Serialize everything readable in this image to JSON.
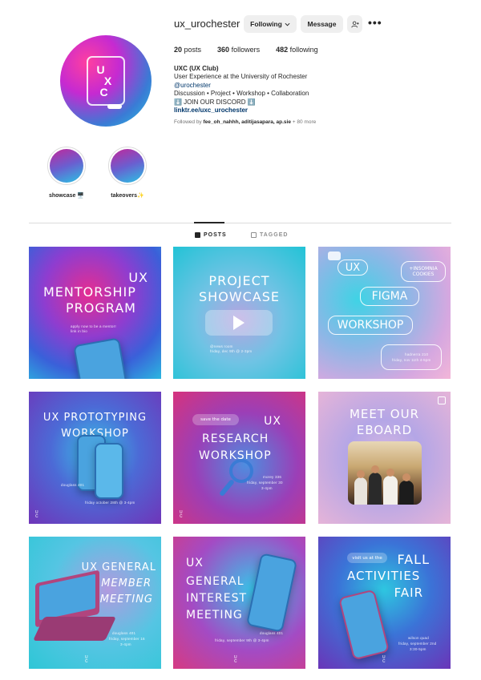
{
  "profile": {
    "username": "ux_urochester",
    "following_button": "Following",
    "message_button": "Message",
    "more": "•••",
    "posts_count": "20",
    "posts_label": "posts",
    "followers_count": "360",
    "followers_label": "followers",
    "following_count": "482",
    "following_label": "following",
    "name": "UXC (UX Club)",
    "bio_line1": "User Experience at the University of Rochester",
    "handle": "@urochester",
    "bio_line2": "Discussion • Project • Workshop • Collaboration",
    "bio_line3": "⬇️ JOIN OUR DISCORD ⬇️",
    "link": "linktr.ee/uxc_urochester",
    "followed_prefix": "Followed by",
    "followed_names": "fee_oh_nahhh, aditijasapara, ap.sie",
    "followed_more": "+ 80 more",
    "avatar_text": [
      "U",
      "X",
      "C"
    ]
  },
  "highlights": [
    {
      "label": "showcase 🖥️"
    },
    {
      "label": "takeovers✨"
    }
  ],
  "tabs": {
    "posts": "POSTS",
    "tagged": "TAGGED"
  },
  "posts": [
    {
      "title_a": "UX",
      "title_b": "MENTORSHIP",
      "title_c": "PROGRAM",
      "small": "apply now to be a mentor! link in bio"
    },
    {
      "title_a": "PROJECT",
      "title_b": "SHOWCASE",
      "small_a": "@news room",
      "small_b": "friday, dec 9th @ 2-3pm"
    },
    {
      "b1": "UX",
      "b2": "+INSOMNIA COOKIES",
      "b3": "FIGMA",
      "b4": "WORKSHOP",
      "small_a": "hadnerra 210",
      "small_b": "friday, nov 11th 4-5pm"
    },
    {
      "title_a": "UX PROTOTYPING",
      "title_b": "WORKSHOP",
      "small_a": "douglass 401",
      "small_b": "friday october 28th @ 3-4pm"
    },
    {
      "tag": "save the date",
      "title_a": "UX",
      "title_b": "RESEARCH",
      "title_c": "WORKSHOP",
      "small_a": "morey 336",
      "small_b": "friday, september 30",
      "small_c": "3-4pm"
    },
    {
      "title_a": "MEET OUR",
      "title_b": "EBOARD"
    },
    {
      "title_a": "UX GENERAL",
      "title_b": "MEMBER",
      "title_c": "MEETING",
      "small_a": "douglass 401",
      "small_b": "friday, september 16",
      "small_c": "3-4pm"
    },
    {
      "title_a": "UX",
      "title_b": "GENERAL",
      "title_c": "INTEREST",
      "title_d": "MEETING",
      "small_a": "douglass 401",
      "small_b": "friday, september 9th @ 3-4pm"
    },
    {
      "tag": "visit us at the",
      "title_a": "FALL",
      "title_b": "ACTIVITIES",
      "title_c": "FAIR",
      "small_a": "wilson quad",
      "small_b": "friday, september 2nd",
      "small_c": "3:30-5pm"
    }
  ]
}
